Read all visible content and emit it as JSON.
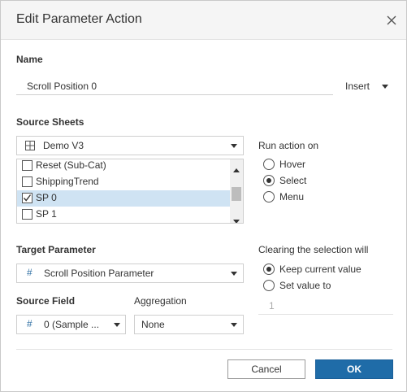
{
  "dialog": {
    "title": "Edit Parameter Action"
  },
  "name": {
    "label": "Name",
    "value": "Scroll Position 0",
    "insert_label": "Insert"
  },
  "source_sheets": {
    "label": "Source Sheets",
    "dashboard": "Demo V3",
    "items": [
      {
        "label": "Reset (Sub-Cat)",
        "checked": false,
        "selected": false
      },
      {
        "label": "ShippingTrend",
        "checked": false,
        "selected": false
      },
      {
        "label": "SP 0",
        "checked": true,
        "selected": true
      },
      {
        "label": "SP 1",
        "checked": false,
        "selected": false
      }
    ]
  },
  "run_action": {
    "label": "Run action on",
    "options": [
      "Hover",
      "Select",
      "Menu"
    ],
    "selected": "Select"
  },
  "target_parameter": {
    "label": "Target Parameter",
    "value": "Scroll Position Parameter"
  },
  "source_field": {
    "label": "Source Field",
    "value": "0 (Sample ..."
  },
  "aggregation": {
    "label": "Aggregation",
    "value": "None"
  },
  "clearing": {
    "label": "Clearing the selection will",
    "options": [
      "Keep current value",
      "Set value to"
    ],
    "selected": "Keep current value",
    "set_value": "1"
  },
  "buttons": {
    "cancel": "Cancel",
    "ok": "OK"
  },
  "colors": {
    "accent": "#1f6ca8",
    "selection": "#cfe3f3"
  },
  "icons": {
    "close": "close-icon",
    "sheet": "grid-icon",
    "param": "hash-icon"
  }
}
